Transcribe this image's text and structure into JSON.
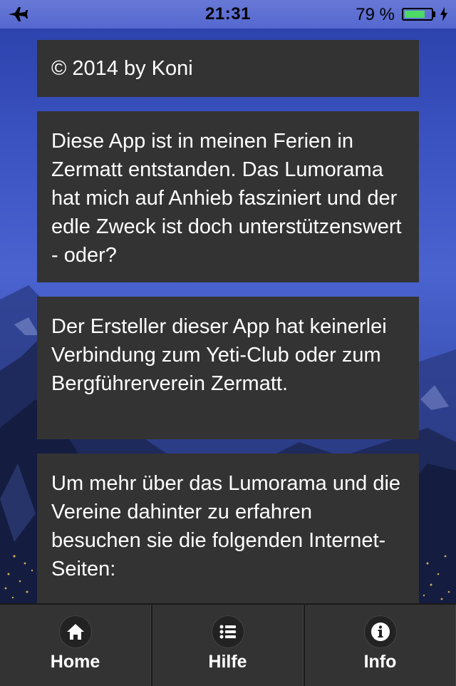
{
  "status_bar": {
    "time": "21:31",
    "battery_percent": "79 %",
    "battery_level": 0.79,
    "icons": [
      "airplane-icon",
      "battery-icon",
      "charging-bolt-icon"
    ]
  },
  "cards": {
    "copyright": "© 2014 by Koni",
    "paragraph_1": "Diese App ist in meinen Ferien in Zermatt entstanden. Das Lumorama hat mich auf Anhieb fasziniert und der edle Zweck ist doch unterstützenswert - oder?",
    "paragraph_2": "Der Ersteller dieser App hat keinerlei Verbindung zum Yeti-Club oder zum Bergführerverein Zermatt.",
    "paragraph_3": "Um mehr über das Lumorama und die Vereine dahinter zu erfahren besuchen sie die folgenden Internet-Seiten:"
  },
  "tab_bar": {
    "tabs": [
      {
        "label": "Home",
        "icon": "home-icon"
      },
      {
        "label": "Hilfe",
        "icon": "list-icon"
      },
      {
        "label": "Info",
        "icon": "info-icon"
      }
    ]
  },
  "colors": {
    "card_bg": "#333333",
    "tab_bg": "#333333",
    "battery_green": "#4cd964",
    "sky_blue": "#3a52c0"
  }
}
